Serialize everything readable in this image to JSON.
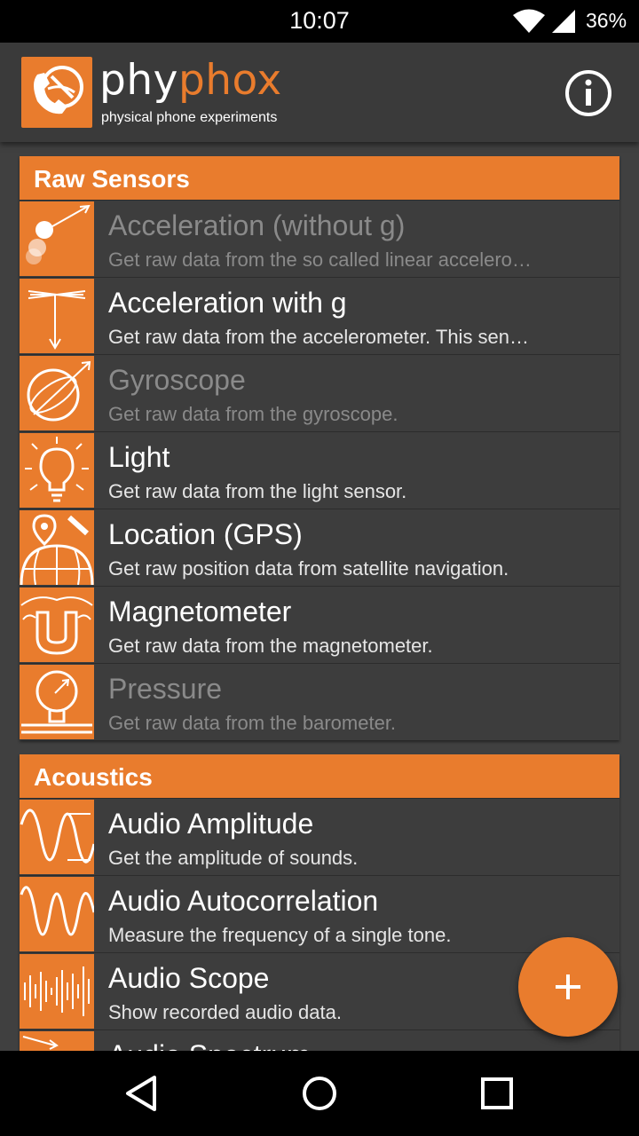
{
  "status": {
    "time": "10:07",
    "battery": "36%"
  },
  "app": {
    "brand_part1": "phy",
    "brand_part2": "phox",
    "tagline": "physical phone experiments"
  },
  "categories": [
    {
      "title": "Raw Sensors",
      "items": [
        {
          "title": "Acceleration (without g)",
          "desc": "Get raw data from the so called linear accelero…",
          "icon": "acceleration-icon",
          "enabled": false
        },
        {
          "title": "Acceleration with g",
          "desc": "Get raw data from the accelerometer. This sen…",
          "icon": "acceleration-g-icon",
          "enabled": true
        },
        {
          "title": "Gyroscope",
          "desc": "Get raw data from the gyroscope.",
          "icon": "gyroscope-icon",
          "enabled": false
        },
        {
          "title": "Light",
          "desc": "Get raw data from the light sensor.",
          "icon": "light-bulb-icon",
          "enabled": true
        },
        {
          "title": "Location (GPS)",
          "desc": "Get raw position data from satellite navigation.",
          "icon": "gps-globe-icon",
          "enabled": true
        },
        {
          "title": "Magnetometer",
          "desc": "Get raw data from the magnetometer.",
          "icon": "magnet-icon",
          "enabled": true
        },
        {
          "title": "Pressure",
          "desc": "Get raw data from the barometer.",
          "icon": "barometer-icon",
          "enabled": false
        }
      ]
    },
    {
      "title": "Acoustics",
      "items": [
        {
          "title": "Audio Amplitude",
          "desc": "Get the amplitude of sounds.",
          "icon": "amplitude-wave-icon",
          "enabled": true
        },
        {
          "title": "Audio Autocorrelation",
          "desc": "Measure the frequency of a single tone.",
          "icon": "autocorrelation-wave-icon",
          "enabled": true
        },
        {
          "title": "Audio Scope",
          "desc": "Show recorded audio data.",
          "icon": "audio-scope-icon",
          "enabled": true
        },
        {
          "title": "Audio Spectrum",
          "desc": "",
          "icon": "spectrum-icon",
          "enabled": true
        }
      ]
    }
  ],
  "colors": {
    "accent": "#e97c2d",
    "background": "#404040",
    "disabled_text": "#8a8a8a"
  },
  "icons": {
    "info": "info-icon",
    "fab": "plus-icon",
    "nav_back": "back-triangle-icon",
    "nav_home": "home-circle-icon",
    "nav_recents": "recents-square-icon"
  }
}
